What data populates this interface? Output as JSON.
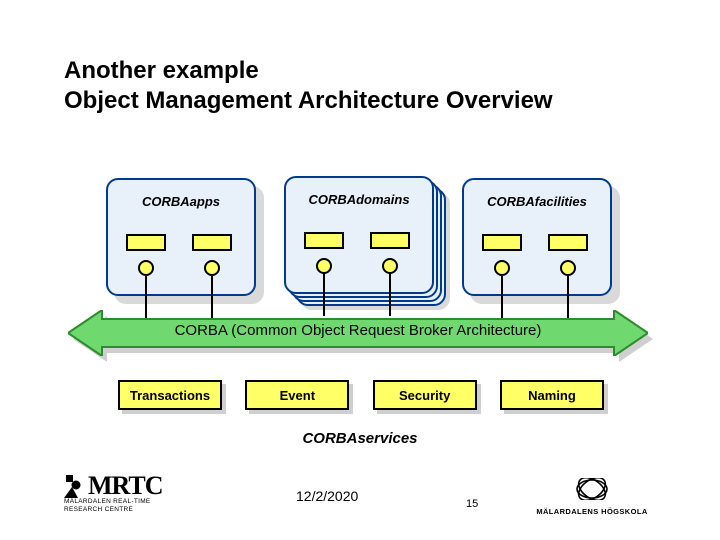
{
  "title": {
    "line1": "Another example",
    "line2": "Object Management Architecture Overview"
  },
  "topBoxes": [
    {
      "label": "CORBAapps"
    },
    {
      "label": "CORBAdomains"
    },
    {
      "label": "CORBAfacilities"
    }
  ],
  "busLabel": "CORBA (Common Object Request  Broker Architecture)",
  "services": [
    {
      "label": "Transactions"
    },
    {
      "label": "Event"
    },
    {
      "label": "Security"
    },
    {
      "label": "Naming"
    }
  ],
  "servicesGroupLabel": "CORBAservices",
  "footer": {
    "date": "12/2/2020",
    "page": "15"
  },
  "logos": {
    "mrtc": {
      "acronym": "MRTC",
      "line1": "MÄLARDALEN REAL-TIME",
      "line2": "RESEARCH CENTRE"
    },
    "malardalens": {
      "text": "MÄLARDALENS HÖGSKOLA"
    }
  },
  "colors": {
    "boxFill": "#e8f0fa",
    "boxBorder": "#003a8c",
    "yellow": "#ffff66",
    "green": "#6fd96f",
    "greenDark": "#2e8b2e"
  }
}
